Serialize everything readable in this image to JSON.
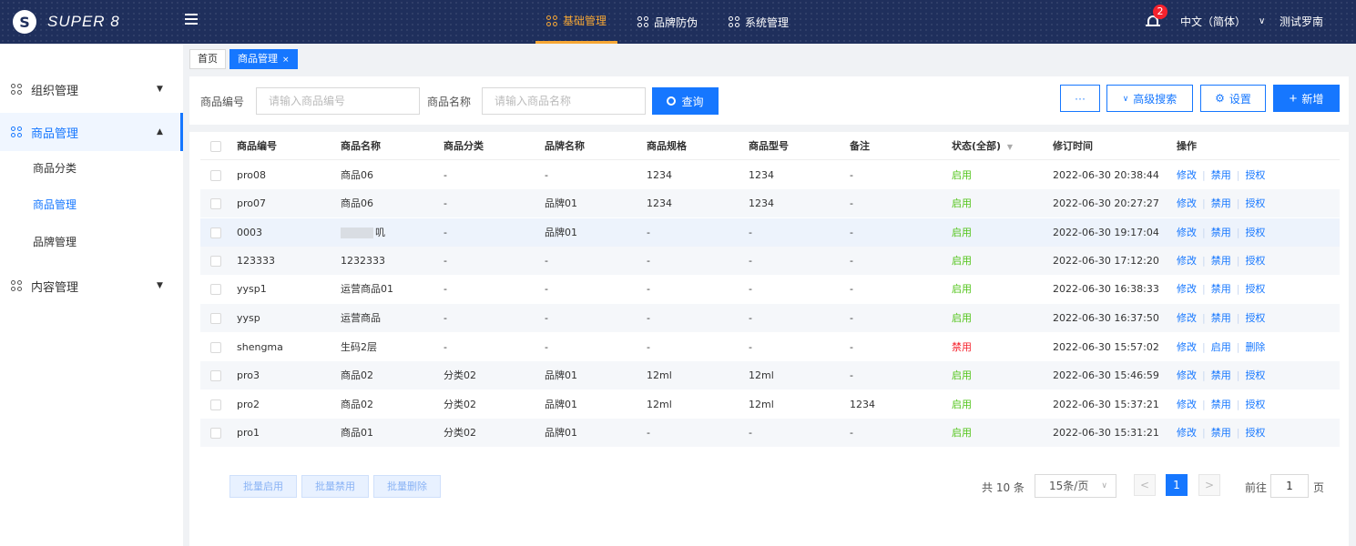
{
  "header": {
    "logo_mark": "S",
    "logo_text": "SUPER 8",
    "nav": [
      {
        "label": "基础管理",
        "active": true
      },
      {
        "label": "品牌防伪",
        "active": false
      },
      {
        "label": "系统管理",
        "active": false
      }
    ],
    "notification_count": "2",
    "language": "中文（简体）",
    "user": "测试罗南"
  },
  "sidebar": {
    "menus": [
      {
        "label": "组织管理"
      },
      {
        "label": "商品管理"
      },
      {
        "label": "内容管理"
      }
    ],
    "sub_items": [
      {
        "label": "商品分类"
      },
      {
        "label": "商品管理"
      },
      {
        "label": "品牌管理"
      }
    ]
  },
  "tabs": [
    {
      "label": "首页"
    },
    {
      "label": "商品管理",
      "close": "×"
    }
  ],
  "search": {
    "code_label": "商品编号",
    "code_placeholder": "请输入商品编号",
    "name_label": "商品名称",
    "name_placeholder": "请输入商品名称",
    "query_button": "查询",
    "more_button": "···",
    "advanced_button": "高级搜索",
    "settings_button": "设置",
    "add_button": "新增"
  },
  "table": {
    "columns": [
      "商品编号",
      "商品名称",
      "商品分类",
      "品牌名称",
      "商品规格",
      "商品型号",
      "备注",
      "状态(全部)",
      "修订时间",
      "操作"
    ],
    "rows": [
      {
        "code": "pro08",
        "name": "商品06",
        "category": "-",
        "brand": "-",
        "spec": "1234",
        "model": "1234",
        "remark": "-",
        "status": "启用",
        "time": "2022-06-30 20:38:44",
        "a1": "修改",
        "a2": "禁用",
        "a3": "授权"
      },
      {
        "code": "pro07",
        "name": "商品06",
        "category": "-",
        "brand": "品牌01",
        "spec": "1234",
        "model": "1234",
        "remark": "-",
        "status": "启用",
        "time": "2022-06-30 20:27:27",
        "a1": "修改",
        "a2": "禁用",
        "a3": "授权"
      },
      {
        "code": "0003",
        "name": "叽",
        "category": "-",
        "brand": "品牌01",
        "spec": "-",
        "model": "-",
        "remark": "-",
        "status": "启用",
        "time": "2022-06-30 19:17:04",
        "a1": "修改",
        "a2": "禁用",
        "a3": "授权"
      },
      {
        "code": "123333",
        "name": "1232333",
        "category": "-",
        "brand": "-",
        "spec": "-",
        "model": "-",
        "remark": "-",
        "status": "启用",
        "time": "2022-06-30 17:12:20",
        "a1": "修改",
        "a2": "禁用",
        "a3": "授权"
      },
      {
        "code": "yysp1",
        "name": "运营商品01",
        "category": "-",
        "brand": "-",
        "spec": "-",
        "model": "-",
        "remark": "-",
        "status": "启用",
        "time": "2022-06-30 16:38:33",
        "a1": "修改",
        "a2": "禁用",
        "a3": "授权"
      },
      {
        "code": "yysp",
        "name": "运营商品",
        "category": "-",
        "brand": "-",
        "spec": "-",
        "model": "-",
        "remark": "-",
        "status": "启用",
        "time": "2022-06-30 16:37:50",
        "a1": "修改",
        "a2": "禁用",
        "a3": "授权"
      },
      {
        "code": "shengma",
        "name": "生码2层",
        "category": "-",
        "brand": "-",
        "spec": "-",
        "model": "-",
        "remark": "-",
        "status": "禁用",
        "time": "2022-06-30 15:57:02",
        "a1": "修改",
        "a2": "启用",
        "a3": "删除"
      },
      {
        "code": "pro3",
        "name": "商品02",
        "category": "分类02",
        "brand": "品牌01",
        "spec": "12ml",
        "model": "12ml",
        "remark": "-",
        "status": "启用",
        "time": "2022-06-30 15:46:59",
        "a1": "修改",
        "a2": "禁用",
        "a3": "授权"
      },
      {
        "code": "pro2",
        "name": "商品02",
        "category": "分类02",
        "brand": "品牌01",
        "spec": "12ml",
        "model": "12ml",
        "remark": "1234",
        "status": "启用",
        "time": "2022-06-30 15:37:21",
        "a1": "修改",
        "a2": "禁用",
        "a3": "授权"
      },
      {
        "code": "pro1",
        "name": "商品01",
        "category": "分类02",
        "brand": "品牌01",
        "spec": "-",
        "model": "-",
        "remark": "-",
        "status": "启用",
        "time": "2022-06-30 15:31:21",
        "a1": "修改",
        "a2": "禁用",
        "a3": "授权"
      }
    ]
  },
  "footer": {
    "batch_enable": "批量启用",
    "batch_disable": "批量禁用",
    "batch_delete": "批量删除",
    "total": "共 10 条",
    "page_size": "15条/页",
    "prev": "<",
    "current_page": "1",
    "next": ">",
    "goto_label": "前往",
    "goto_value": "1",
    "goto_suffix": "页"
  },
  "colors": {
    "header_bg": "#1f2f5c",
    "accent": "#1677ff",
    "active_nav": "#f7a734",
    "enabled": "#52c41a",
    "disabled": "#f5222d"
  }
}
